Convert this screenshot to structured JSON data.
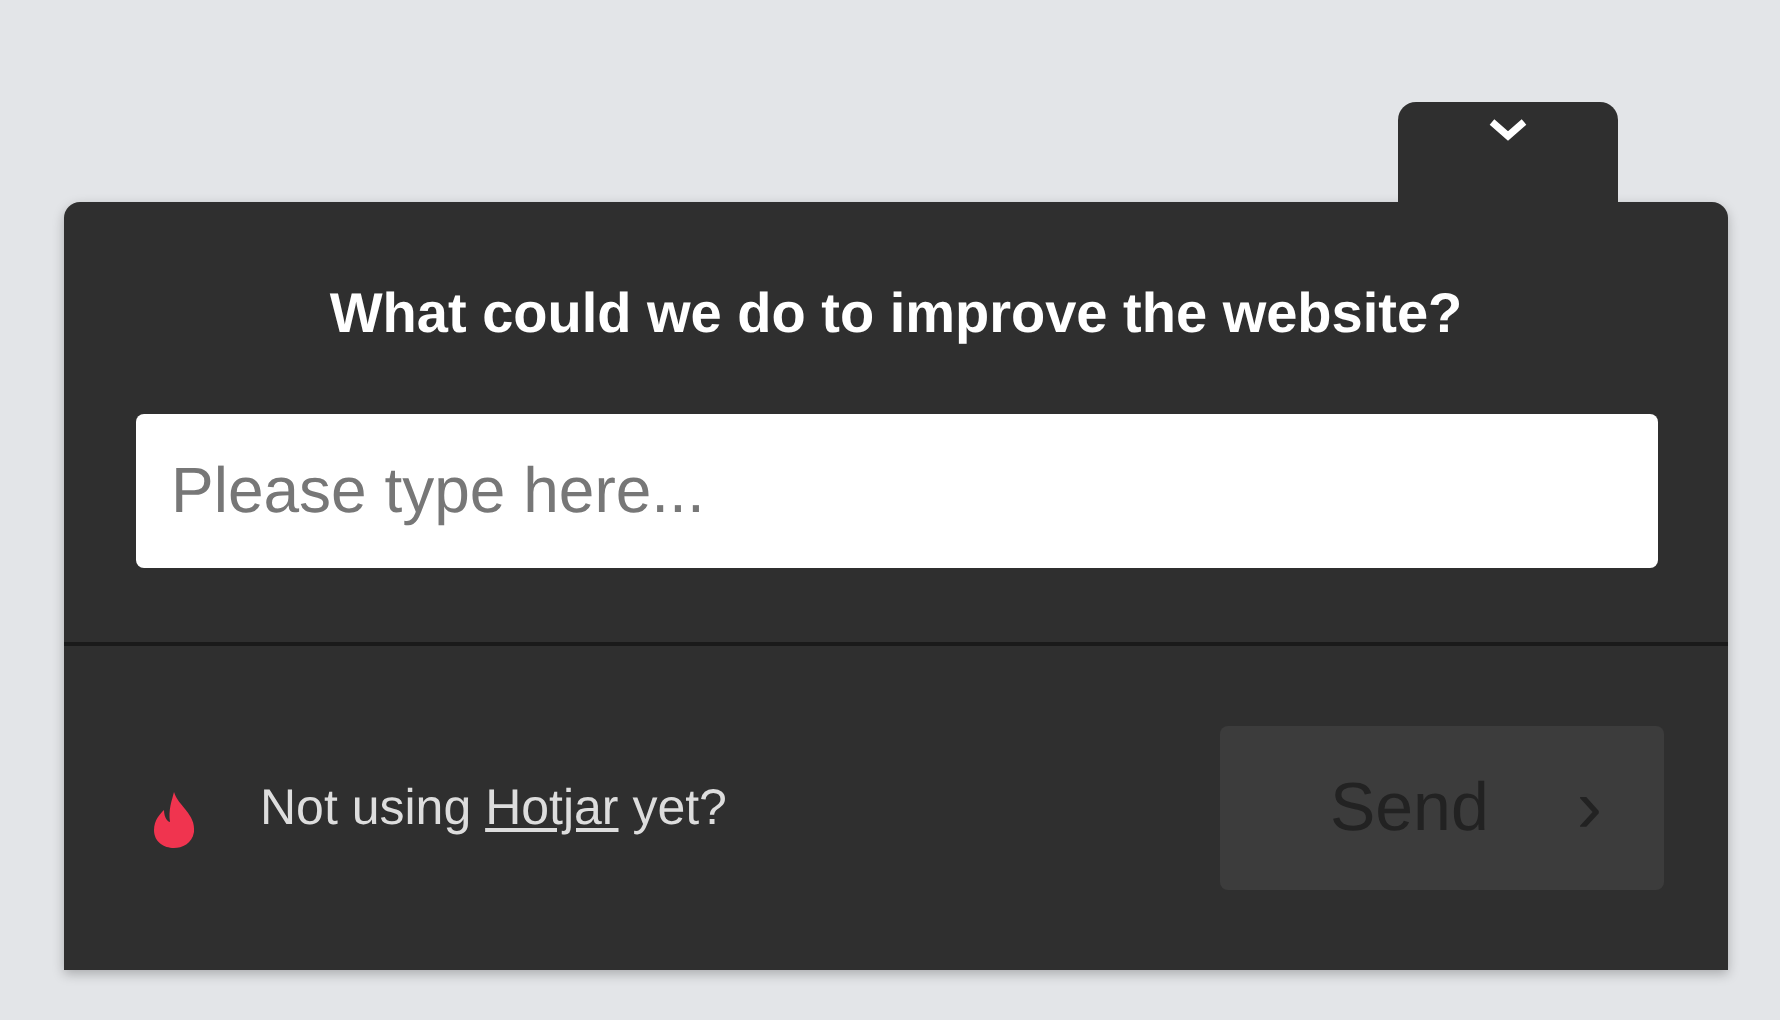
{
  "question": "What could we do to improve the website?",
  "input": {
    "placeholder": "Please type here..."
  },
  "footer": {
    "before": "Not using",
    "link": "Hotjar",
    "after": "yet?"
  },
  "send_button": {
    "label": "Send",
    "icon": "›",
    "disabled": true
  }
}
